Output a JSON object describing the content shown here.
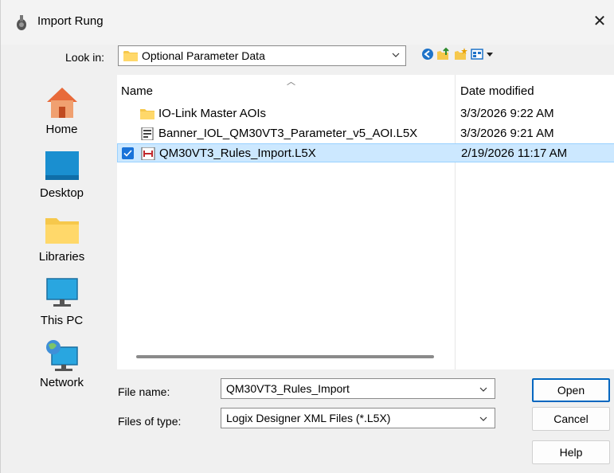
{
  "dialog": {
    "title": "Import Rung",
    "close_label": "✕"
  },
  "look_in": {
    "label": "Look in:",
    "value": "Optional Parameter Data"
  },
  "places": [
    {
      "label": "Home",
      "icon": "home-icon"
    },
    {
      "label": "Desktop",
      "icon": "desktop-icon"
    },
    {
      "label": "Libraries",
      "icon": "libraries-icon"
    },
    {
      "label": "This PC",
      "icon": "this-pc-icon"
    },
    {
      "label": "Network",
      "icon": "network-icon"
    }
  ],
  "file_list": {
    "columns": {
      "name": "Name",
      "date": "Date modified"
    },
    "rows": [
      {
        "name": "IO-Link Master AOIs",
        "date": "3/3/2026 9:22 AM",
        "icon": "folder-icon",
        "selected": false
      },
      {
        "name": "Banner_IOL_QM30VT3_Parameter_v5_AOI.L5X",
        "date": "3/3/2026 9:21 AM",
        "icon": "l5x-file-icon",
        "selected": false
      },
      {
        "name": "QM30VT3_Rules_Import.L5X",
        "date": "2/19/2026 11:17 AM",
        "icon": "rung-file-icon",
        "selected": true
      }
    ]
  },
  "file_name": {
    "label": "File name:",
    "value": "QM30VT3_Rules_Import"
  },
  "file_type": {
    "label": "Files of type:",
    "value": "Logix Designer XML Files (*.L5X)"
  },
  "buttons": {
    "open": "Open",
    "cancel": "Cancel",
    "help": "Help"
  },
  "colors": {
    "selection": "#cce8ff",
    "accent": "#0067c0",
    "folder": "#f6c84c"
  }
}
